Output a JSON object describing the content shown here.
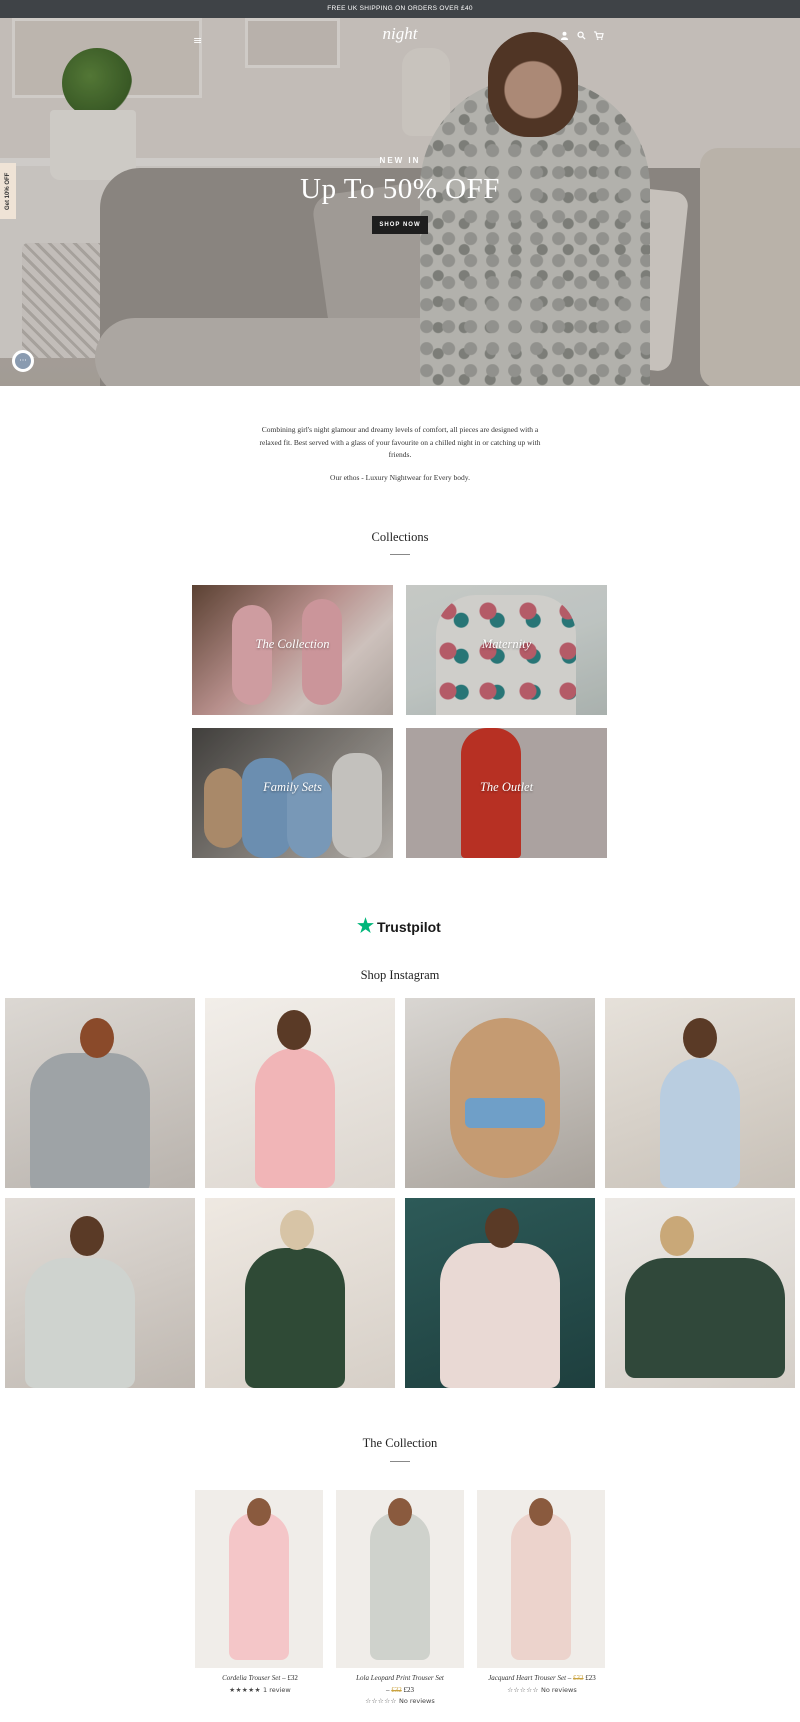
{
  "announcement": "FREE UK SHIPPING ON ORDERS OVER £40",
  "header": {
    "logo": "night",
    "menu_icon": "≡",
    "account_icon": "person-icon",
    "search_icon": "search-icon",
    "cart_icon": "cart-icon"
  },
  "hero": {
    "subtitle": "NEW IN",
    "title": "Up To 50% OFF",
    "button": "SHOP NOW"
  },
  "side_tab": "Get 10% OFF",
  "intro": {
    "text": "Combining girl's night glamour and dreamy levels of comfort, all pieces are designed with a relaxed fit. Best served with a glass of your favourite on a chilled night in or catching up with friends.",
    "ethos": "Our ethos - Luxury Nightwear for Every body."
  },
  "collections": {
    "title": "Collections",
    "items": [
      {
        "label": "The Collection"
      },
      {
        "label": "Maternity"
      },
      {
        "label": "Family Sets"
      },
      {
        "label": "The Outlet"
      }
    ]
  },
  "trustpilot": {
    "label": "Trustpilot"
  },
  "instagram": {
    "title": "Shop Instagram"
  },
  "the_collection": {
    "title": "The Collection",
    "products": [
      {
        "name": "Cordelia Trouser Set",
        "price": "£32",
        "stars": "★★★★★",
        "reviews": "1 review"
      },
      {
        "name": "Lola Leopard Print Trouser Set",
        "old_price": "£32",
        "price": "£23",
        "stars": "☆☆☆☆☆",
        "reviews": "No reviews"
      },
      {
        "name": "Jacquard Heart Trouser Set",
        "old_price": "£32",
        "price": "£23",
        "stars": "☆☆☆☆☆",
        "reviews": "No reviews"
      }
    ]
  },
  "colors": {
    "announcement_bg": "#3f4347",
    "trustpilot_green": "#00b67a",
    "sale_price": "#c9a23f"
  }
}
